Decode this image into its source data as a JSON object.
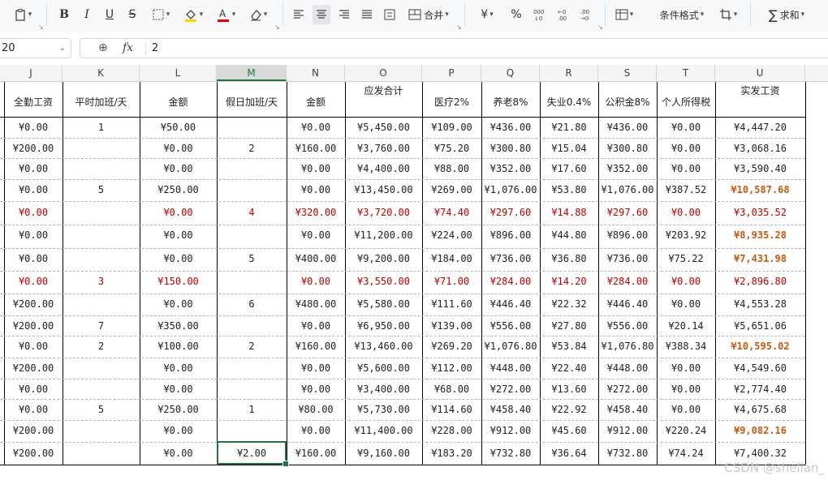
{
  "toolbar": {
    "bold": "B",
    "italic": "I",
    "underline": "U",
    "strike": "S",
    "merge": "合并",
    "currency": "¥",
    "percent": "%",
    "cond_format": "条件格式",
    "sum": "求和"
  },
  "formula_bar": {
    "cell_ref": "20",
    "fx": "fx",
    "value": "2"
  },
  "columns": [
    "J",
    "K",
    "L",
    "M",
    "N",
    "O",
    "P",
    "Q",
    "R",
    "S",
    "T",
    "U"
  ],
  "headers": [
    "全勤工资",
    "平时加班/天",
    "金额",
    "假日加班/天",
    "金额",
    "应发合计",
    "医疗2%",
    "养老8%",
    "失业0.4%",
    "公积金8%",
    "个人所得税",
    "实发工资"
  ],
  "rows": [
    {
      "style": "normal",
      "cells": [
        "¥0.00",
        "1",
        "¥50.00",
        "",
        "¥0.00",
        "¥5,450.00",
        "¥109.00",
        "¥436.00",
        "¥21.80",
        "¥436.00",
        "¥0.00",
        "¥4,447.20"
      ]
    },
    {
      "style": "normal",
      "cells": [
        "¥200.00",
        "",
        "¥0.00",
        "2",
        "¥160.00",
        "¥3,760.00",
        "¥75.20",
        "¥300.80",
        "¥15.04",
        "¥300.80",
        "¥0.00",
        "¥3,068.16"
      ]
    },
    {
      "style": "normal",
      "cells": [
        "¥0.00",
        "",
        "¥0.00",
        "",
        "¥0.00",
        "¥4,400.00",
        "¥88.00",
        "¥352.00",
        "¥17.60",
        "¥352.00",
        "¥0.00",
        "¥3,590.40"
      ]
    },
    {
      "style": "hl",
      "cells": [
        "¥0.00",
        "5",
        "¥250.00",
        "",
        "¥0.00",
        "¥13,450.00",
        "¥269.00",
        "¥1,076.00",
        "¥53.80",
        "¥1,076.00",
        "¥387.52",
        "¥10,587.68"
      ]
    },
    {
      "style": "red",
      "cells": [
        "¥0.00",
        "",
        "¥0.00",
        "4",
        "¥320.00",
        "¥3,720.00",
        "¥74.40",
        "¥297.60",
        "¥14.88",
        "¥297.60",
        "¥0.00",
        "¥3,035.52"
      ]
    },
    {
      "style": "hl",
      "cells": [
        "¥0.00",
        "",
        "¥0.00",
        "",
        "¥0.00",
        "¥11,200.00",
        "¥224.00",
        "¥896.00",
        "¥44.80",
        "¥896.00",
        "¥203.92",
        "¥8,935.28"
      ]
    },
    {
      "style": "hl",
      "cells": [
        "¥0.00",
        "",
        "¥0.00",
        "5",
        "¥400.00",
        "¥9,200.00",
        "¥184.00",
        "¥736.00",
        "¥36.80",
        "¥736.00",
        "¥75.22",
        "¥7,431.98"
      ]
    },
    {
      "style": "red",
      "cells": [
        "¥0.00",
        "3",
        "¥150.00",
        "",
        "¥0.00",
        "¥3,550.00",
        "¥71.00",
        "¥284.00",
        "¥14.20",
        "¥284.00",
        "¥0.00",
        "¥2,896.80"
      ]
    },
    {
      "style": "normal",
      "cells": [
        "¥200.00",
        "",
        "¥0.00",
        "6",
        "¥480.00",
        "¥5,580.00",
        "¥111.60",
        "¥446.40",
        "¥22.32",
        "¥446.40",
        "¥0.00",
        "¥4,553.28"
      ]
    },
    {
      "style": "normal",
      "cells": [
        "¥200.00",
        "7",
        "¥350.00",
        "",
        "¥0.00",
        "¥6,950.00",
        "¥139.00",
        "¥556.00",
        "¥27.80",
        "¥556.00",
        "¥20.14",
        "¥5,651.06"
      ]
    },
    {
      "style": "hl",
      "cells": [
        "¥0.00",
        "2",
        "¥100.00",
        "2",
        "¥160.00",
        "¥13,460.00",
        "¥269.20",
        "¥1,076.80",
        "¥53.84",
        "¥1,076.80",
        "¥388.34",
        "¥10,595.02"
      ]
    },
    {
      "style": "normal",
      "cells": [
        "¥200.00",
        "",
        "¥0.00",
        "",
        "¥0.00",
        "¥5,600.00",
        "¥112.00",
        "¥448.00",
        "¥22.40",
        "¥448.00",
        "¥0.00",
        "¥4,549.60"
      ]
    },
    {
      "style": "normal",
      "cells": [
        "¥0.00",
        "",
        "¥0.00",
        "",
        "¥0.00",
        "¥3,400.00",
        "¥68.00",
        "¥272.00",
        "¥13.60",
        "¥272.00",
        "¥0.00",
        "¥2,774.40"
      ]
    },
    {
      "style": "normal",
      "cells": [
        "¥0.00",
        "5",
        "¥250.00",
        "1",
        "¥80.00",
        "¥5,730.00",
        "¥114.60",
        "¥458.40",
        "¥22.92",
        "¥458.40",
        "¥0.00",
        "¥4,675.68"
      ]
    },
    {
      "style": "hl",
      "cells": [
        "¥200.00",
        "",
        "¥0.00",
        "",
        "¥0.00",
        "¥11,400.00",
        "¥228.00",
        "¥912.00",
        "¥45.60",
        "¥912.00",
        "¥220.24",
        "¥9,082.16"
      ]
    },
    {
      "style": "normal",
      "cells": [
        "¥200.00",
        "",
        "¥0.00",
        "¥2.00",
        "¥160.00",
        "¥9,160.00",
        "¥183.20",
        "¥732.80",
        "¥36.64",
        "¥732.80",
        "¥74.24",
        "¥7,400.32"
      ]
    }
  ],
  "selected_column": "M",
  "colors": {
    "accent": "#217346",
    "red_text": "#c00000",
    "highlight_text": "#c55a11"
  },
  "watermark": "CSDN @shelian_"
}
